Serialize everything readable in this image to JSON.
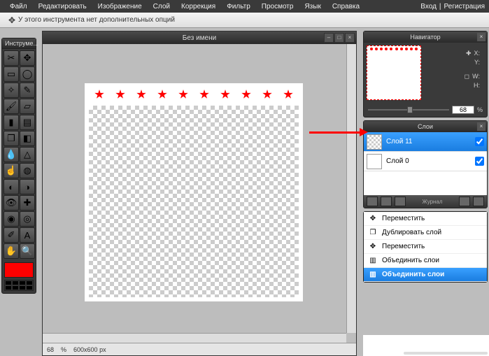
{
  "menu": {
    "file": "Файл",
    "edit": "Редактировать",
    "image": "Изображение",
    "layer": "Слой",
    "adjust": "Коррекция",
    "filter": "Фильтр",
    "view": "Просмотр",
    "lang": "Язык",
    "help": "Справка"
  },
  "auth": {
    "login": "Вход",
    "sep": "|",
    "register": "Регистрация"
  },
  "optbar": {
    "text": "У этого инструмента нет дополнительных опций"
  },
  "toolbox": {
    "title": "Инструме..."
  },
  "tools": [
    "crop",
    "move",
    "marquee",
    "lasso",
    "wand",
    "pencil",
    "brush",
    "eraser",
    "bucket",
    "gradient",
    "clone",
    "colorReplace",
    "blur",
    "sharpen",
    "smudge",
    "sponge",
    "dodge",
    "burn",
    "redeye",
    "spotheal",
    "bloat",
    "pinch",
    "picker",
    "type",
    "hand",
    "zoom"
  ],
  "toolIcons": {
    "crop": "✂",
    "move": "✥",
    "marquee": "▭",
    "lasso": "◯",
    "wand": "✧",
    "pencil": "✎",
    "brush": "🖌",
    "eraser": "▱",
    "bucket": "▮",
    "gradient": "▤",
    "clone": "❐",
    "colorReplace": "◧",
    "blur": "💧",
    "sharpen": "△",
    "smudge": "☝",
    "sponge": "◍",
    "dodge": "◐",
    "burn": "◑",
    "redeye": "👁",
    "spotheal": "✚",
    "bloat": "◉",
    "pinch": "◎",
    "picker": "✐",
    "type": "A",
    "hand": "✋",
    "zoom": "🔍"
  },
  "doc": {
    "title": "Без имени"
  },
  "status": {
    "zoom": "68",
    "zoomUnit": "%",
    "dims": "600x600 px"
  },
  "nav": {
    "title": "Навигатор",
    "x": "X:",
    "y": "Y:",
    "w": "W:",
    "h": "H:",
    "zoom": "68",
    "zoomUnit": "%"
  },
  "layers": {
    "title": "Слои",
    "items": [
      {
        "name": "Слой 11",
        "selected": true,
        "checked": true,
        "transparent": true
      },
      {
        "name": "Слой 0",
        "selected": false,
        "checked": true,
        "transparent": false
      }
    ]
  },
  "history": {
    "title": "Журнал"
  },
  "context": {
    "items": [
      {
        "label": "Переместить",
        "icon": "✥",
        "selected": false
      },
      {
        "label": "Дублировать слой",
        "icon": "❐",
        "selected": false
      },
      {
        "label": "Переместить",
        "icon": "✥",
        "selected": false
      },
      {
        "label": "Объединить слои",
        "icon": "▥",
        "selected": false
      },
      {
        "label": "Объединить слои",
        "icon": "▥",
        "selected": true
      }
    ]
  },
  "colors": {
    "accent": "#ff0000",
    "selection": "#2a8de0"
  }
}
